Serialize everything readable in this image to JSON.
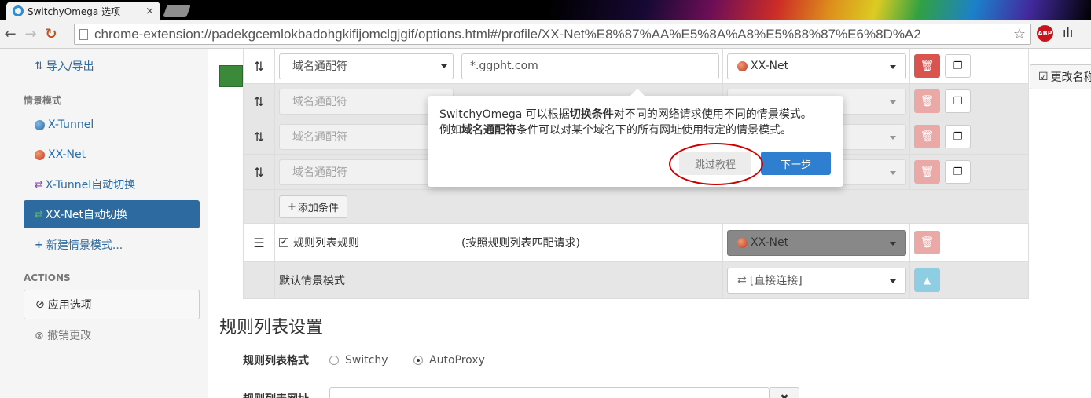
{
  "browser": {
    "tab_title": "SwitchyOmega 选项",
    "tab_close": "×",
    "url": "chrome-extension://padekgcemlokbadohgkifijomclgjgif/options.html#/profile/XX-Net%E8%87%AA%E5%8A%A8%E5%88%87%E6%8D%A2",
    "abp_label": "ABP"
  },
  "sidebar": {
    "import_export": "导入/导出",
    "profiles_header": "情景模式",
    "profiles": [
      {
        "label": "X-Tunnel",
        "icon": "globe-blue"
      },
      {
        "label": "XX-Net",
        "icon": "globe-red"
      },
      {
        "label": "X-Tunnel自动切换",
        "icon": "switch-purple"
      },
      {
        "label": "XX-Net自动切换",
        "icon": "switch-green",
        "active": true
      }
    ],
    "new_profile": "新建情景模式...",
    "actions_header": "ACTIONS",
    "apply": "应用选项",
    "undo": "撤销更改"
  },
  "main": {
    "rename_label": "更改名称",
    "rules": [
      {
        "type": "域名通配符",
        "pattern": "*.ggpht.com",
        "profile": "XX-Net"
      },
      {
        "type": "域名通配符",
        "pattern": "",
        "profile": ""
      },
      {
        "type": "域名通配符",
        "pattern": "",
        "profile": ""
      },
      {
        "type": "域名通配符",
        "pattern": "",
        "profile": ""
      }
    ],
    "add_condition": "添加条件",
    "rulelist_rule": {
      "label": "规则列表规则",
      "desc": "(按照规则列表匹配请求)",
      "profile": "XX-Net"
    },
    "default_rule": {
      "label": "默认情景模式",
      "profile": "[直接连接]"
    },
    "rulelist_settings_title": "规则列表设置",
    "format_label": "规则列表格式",
    "format_options": [
      "Switchy",
      "AutoProxy"
    ],
    "format_selected": "AutoProxy",
    "url_label": "规则列表网址"
  },
  "tutorial": {
    "line1_a": "SwitchyOmega 可以根据",
    "line1_b": "切换条件",
    "line1_c": "对不同的网络请求使用不同的情景模式。",
    "line2_a": "例如",
    "line2_b": "域名通配符",
    "line2_c": "条件可以对某个域名下的所有网址使用特定的情景模式。",
    "skip": "跳过教程",
    "next": "下一步"
  },
  "colors": {
    "accent": "#2c6aa0",
    "danger": "#d9534f",
    "primary": "#2f7fd1",
    "annotation": "#cc0000"
  }
}
